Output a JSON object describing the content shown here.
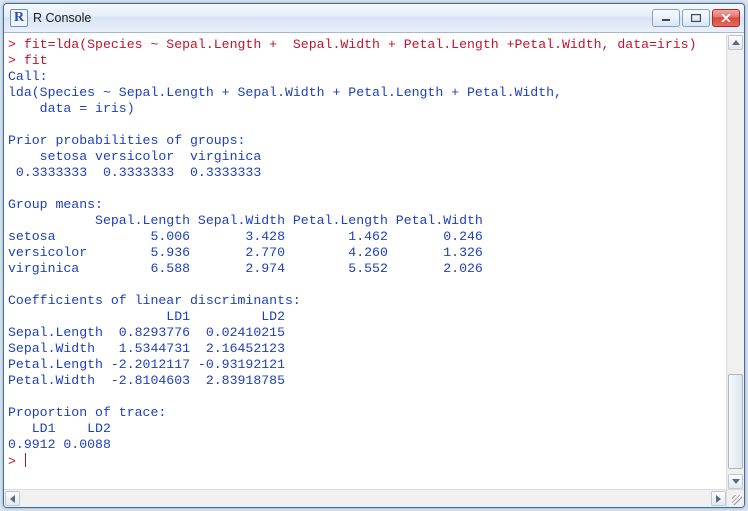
{
  "window": {
    "title": "R Console",
    "icon_letter": "R"
  },
  "prompt": "> ",
  "commands": {
    "line1": "fit=lda(Species ~ Sepal.Length +  Sepal.Width + Petal.Length +Petal.Width, data=iris)",
    "line2": "fit"
  },
  "output": {
    "call_header": "Call:",
    "call_body1": "lda(Species ~ Sepal.Length + Sepal.Width + Petal.Length + Petal.Width, ",
    "call_body2": "    data = iris)",
    "priors_header": "Prior probabilities of groups:",
    "priors_names": "    setosa versicolor  virginica ",
    "priors_vals": " 0.3333333  0.3333333  0.3333333 ",
    "means_header": "Group means:",
    "means_cols": "           Sepal.Length Sepal.Width Petal.Length Petal.Width",
    "means_row1": "setosa            5.006       3.428        1.462       0.246",
    "means_row2": "versicolor        5.936       2.770        4.260       1.326",
    "means_row3": "virginica         6.588       2.974        5.552       2.026",
    "coef_header": "Coefficients of linear discriminants:",
    "coef_cols": "                    LD1         LD2",
    "coef_row1": "Sepal.Length  0.8293776  0.02410215",
    "coef_row2": "Sepal.Width   1.5344731  2.16452123",
    "coef_row3": "Petal.Length -2.2012117 -0.93192121",
    "coef_row4": "Petal.Width  -2.8104603  2.83918785",
    "trace_header": "Proportion of trace:",
    "trace_cols": "   LD1    LD2 ",
    "trace_vals": "0.9912 0.0088 "
  }
}
